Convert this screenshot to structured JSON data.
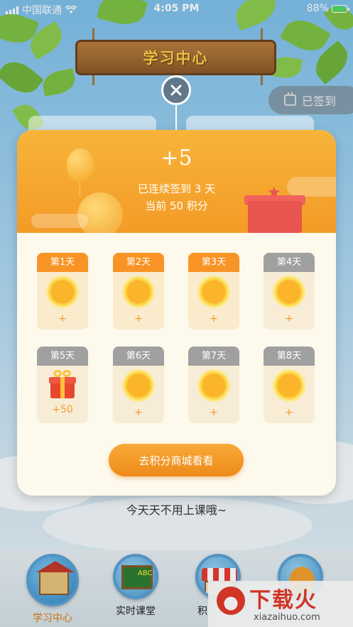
{
  "status_bar": {
    "carrier": "中国联通",
    "time": "4:05 PM",
    "battery": "88%"
  },
  "header": {
    "title": "学习中心",
    "signed_label": "已签到"
  },
  "background_text": "今天天不用上课哦~",
  "bottom_nav": [
    {
      "label": "学习中心",
      "active": true,
      "icon": "house-icon"
    },
    {
      "label": "实时课堂",
      "active": false,
      "icon": "blackboard-icon"
    },
    {
      "label": "积",
      "active": false,
      "icon": "shop-icon"
    },
    {
      "label": "",
      "active": false,
      "icon": "pet-icon"
    }
  ],
  "modal": {
    "points_gained": "+5",
    "streak_text": "已连续签到 3 天",
    "current_points_text": "当前 50 积分",
    "days": [
      {
        "label": "第1天",
        "status": "done",
        "reward": "+"
      },
      {
        "label": "第2天",
        "status": "done",
        "reward": "+"
      },
      {
        "label": "第3天",
        "status": "done",
        "reward": "+"
      },
      {
        "label": "第4天",
        "status": "pending",
        "reward": "+"
      },
      {
        "label": "第5天",
        "status": "gift",
        "reward": "+50"
      },
      {
        "label": "第6天",
        "status": "pending",
        "reward": "+"
      },
      {
        "label": "第7天",
        "status": "pending",
        "reward": "+"
      },
      {
        "label": "第8天",
        "status": "pending",
        "reward": "+"
      }
    ],
    "shop_button": "去积分商城看看"
  },
  "watermark": {
    "title": "下载火",
    "subtitle": "xiazaihuo.com"
  },
  "colors": {
    "accent": "#f39b26",
    "done_label": "#f79425",
    "pending_label": "#a0a0a0",
    "card_bg": "#fdf9ec"
  }
}
